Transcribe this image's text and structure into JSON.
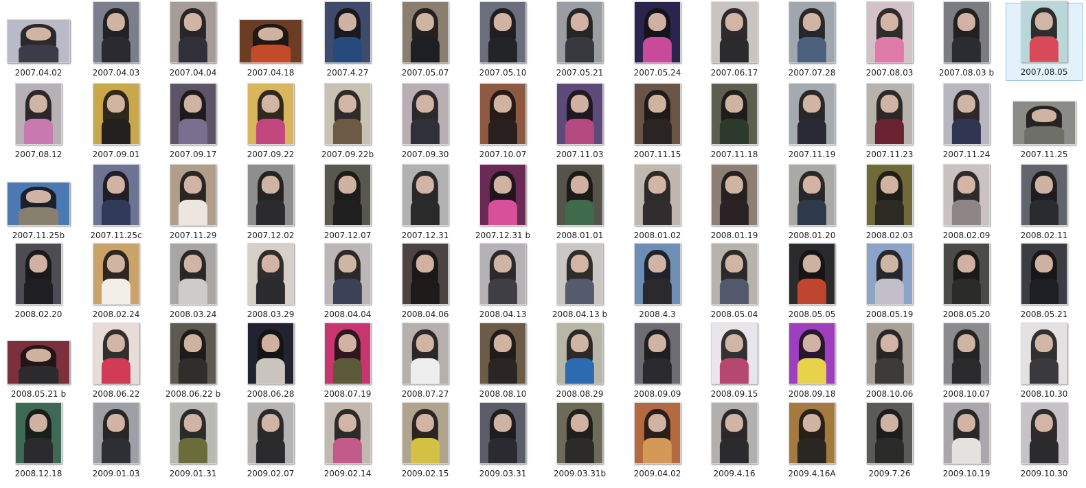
{
  "folder": {
    "rows": [
      [
        {
          "name": "2007.04.02",
          "shape": "landscape",
          "bg": "#b9b9c7",
          "body": "#3b3b4a"
        },
        {
          "name": "2007.04.03",
          "shape": "portrait",
          "bg": "#7b7f8c",
          "body": "#2b2a30"
        },
        {
          "name": "2007.04.04",
          "shape": "portrait",
          "bg": "#a59c97",
          "body": "#313039"
        },
        {
          "name": "2007.04.18",
          "shape": "landscape",
          "bg": "#6b3e24",
          "body": "#c24b2b"
        },
        {
          "name": "2007.4.27",
          "shape": "portrait",
          "bg": "#3e4b6c",
          "body": "#274a7d"
        },
        {
          "name": "2007.05.07",
          "shape": "portrait",
          "bg": "#8a7f6e",
          "body": "#1e1f24"
        },
        {
          "name": "2007.05.10",
          "shape": "portrait",
          "bg": "#6b6e7d",
          "body": "#232428"
        },
        {
          "name": "2007.05.21",
          "shape": "portrait",
          "bg": "#9a9da2",
          "body": "#37393f"
        },
        {
          "name": "2007.05.24",
          "shape": "portrait",
          "bg": "#2a244e",
          "body": "#c84b9b"
        },
        {
          "name": "2007.06.17",
          "shape": "portrait",
          "bg": "#c8c4c1",
          "body": "#2b2a2d"
        },
        {
          "name": "2007.07.28",
          "shape": "portrait",
          "bg": "#9fa6ad",
          "body": "#4c5f7d"
        },
        {
          "name": "2007.08.03",
          "shape": "portrait",
          "bg": "#d2c2c7",
          "body": "#e07aa8"
        },
        {
          "name": "2007.08.03 b",
          "shape": "portrait",
          "bg": "#7a7c82",
          "body": "#2b2c31"
        },
        {
          "name": "2007.08.05",
          "shape": "portrait",
          "bg": "#b9d6d8",
          "body": "#d84a5a",
          "selected": true
        }
      ],
      [
        {
          "name": "2007.08.12",
          "shape": "portrait",
          "bg": "#b7b1b6",
          "body": "#c97ab0"
        },
        {
          "name": "2007.09.01",
          "shape": "portrait",
          "bg": "#c8a84b",
          "body": "#22211f"
        },
        {
          "name": "2007.09.17",
          "shape": "portrait",
          "bg": "#5e5468",
          "body": "#7a6f8e"
        },
        {
          "name": "2007.09.22",
          "shape": "portrait",
          "bg": "#d9b65e",
          "body": "#c2467f"
        },
        {
          "name": "2007.09.22b",
          "shape": "portrait",
          "bg": "#c9c1b2",
          "body": "#6c5a44"
        },
        {
          "name": "2007.09.30",
          "shape": "portrait",
          "bg": "#b8aeb3",
          "body": "#30303a"
        },
        {
          "name": "2007.10.07",
          "shape": "portrait",
          "bg": "#8f5a42",
          "body": "#2a2020"
        },
        {
          "name": "2007.11.03",
          "shape": "portrait",
          "bg": "#5e4a7a",
          "body": "#b44a7f"
        },
        {
          "name": "2007.11.15",
          "shape": "portrait",
          "bg": "#6a5447",
          "body": "#2a2422"
        },
        {
          "name": "2007.11.18",
          "shape": "portrait",
          "bg": "#5c5e4f",
          "body": "#2d3a2b"
        },
        {
          "name": "2007.11.19",
          "shape": "portrait",
          "bg": "#a5a9b0",
          "body": "#2a2a36"
        },
        {
          "name": "2007.11.23",
          "shape": "portrait",
          "bg": "#b7b2ab",
          "body": "#6a2331"
        },
        {
          "name": "2007.11.24",
          "shape": "portrait",
          "bg": "#b8b6be",
          "body": "#303552"
        },
        {
          "name": "2007.11.25",
          "shape": "landscape",
          "bg": "#8b8b88",
          "body": "#6f6f6a"
        }
      ],
      [
        {
          "name": "2007.11.25b",
          "shape": "landscape",
          "bg": "#4c79b4",
          "body": "#88806e"
        },
        {
          "name": "2007.11.25c",
          "shape": "portrait",
          "bg": "#6c7393",
          "body": "#313a5b"
        },
        {
          "name": "2007.11.29",
          "shape": "portrait",
          "bg": "#b19e8a",
          "body": "#ece6df"
        },
        {
          "name": "2007.12.02",
          "shape": "portrait",
          "bg": "#8e8e8f",
          "body": "#2b2b2d"
        },
        {
          "name": "2007.12.07",
          "shape": "portrait",
          "bg": "#59584f",
          "body": "#1f1f20"
        },
        {
          "name": "2007.12.31",
          "shape": "portrait",
          "bg": "#b2b1b2",
          "body": "#2a2a2b"
        },
        {
          "name": "2007.12.31 b",
          "shape": "portrait",
          "bg": "#6a2a56",
          "body": "#d84f9a"
        },
        {
          "name": "2008.01.01",
          "shape": "portrait",
          "bg": "#56534a",
          "body": "#3f6b4c"
        },
        {
          "name": "2008.01.02",
          "shape": "portrait",
          "bg": "#c0b8ae",
          "body": "#322c2e"
        },
        {
          "name": "2008.01.19",
          "shape": "portrait",
          "bg": "#8e7f76",
          "body": "#2a2224"
        },
        {
          "name": "2008.01.20",
          "shape": "portrait",
          "bg": "#a9a9a6",
          "body": "#2e3a4a"
        },
        {
          "name": "2008.02.03",
          "shape": "portrait",
          "bg": "#6f6a37",
          "body": "#2b2a23"
        },
        {
          "name": "2008.02.09",
          "shape": "portrait",
          "bg": "#c9c2c1",
          "body": "#8e8586"
        },
        {
          "name": "2008.02.11",
          "shape": "portrait",
          "bg": "#61646c",
          "body": "#2a2b31"
        }
      ],
      [
        {
          "name": "2008.02.20",
          "shape": "portrait",
          "bg": "#4d4c52",
          "body": "#1f1e23"
        },
        {
          "name": "2008.02.24",
          "shape": "portrait",
          "bg": "#c9a36a",
          "body": "#f2efe8"
        },
        {
          "name": "2008.03.24",
          "shape": "portrait",
          "bg": "#a8a6a4",
          "body": "#cfcbc8"
        },
        {
          "name": "2008.03.29",
          "shape": "portrait",
          "bg": "#d6d0c8",
          "body": "#2b2a2c"
        },
        {
          "name": "2008.04.04",
          "shape": "portrait",
          "bg": "#bcb6b7",
          "body": "#3b4257"
        },
        {
          "name": "2008.04.06",
          "shape": "portrait",
          "bg": "#4b4443",
          "body": "#1f1b1b"
        },
        {
          "name": "2008.04.13",
          "shape": "portrait",
          "bg": "#b4b2b5",
          "body": "#3f3f45"
        },
        {
          "name": "2008.04.13 b",
          "shape": "portrait",
          "bg": "#c9c6c3",
          "body": "#565a6d"
        },
        {
          "name": "2008.4.3",
          "shape": "portrait",
          "bg": "#6d8fb5",
          "body": "#2a2a2e"
        },
        {
          "name": "2008.05.04",
          "shape": "portrait",
          "bg": "#b6b3ad",
          "body": "#53596d"
        },
        {
          "name": "2008.05.05",
          "shape": "portrait",
          "bg": "#2b2a2c",
          "body": "#c0452f"
        },
        {
          "name": "2008.05.19",
          "shape": "portrait",
          "bg": "#8da3c7",
          "body": "#c2bfc8"
        },
        {
          "name": "2008.05.20",
          "shape": "portrait",
          "bg": "#4b4c48",
          "body": "#2b2c2a"
        },
        {
          "name": "2008.05.21",
          "shape": "portrait",
          "bg": "#3c3d43",
          "body": "#1e1f24"
        }
      ],
      [
        {
          "name": "2008.05.21 b",
          "shape": "landscape",
          "bg": "#7c2f3c",
          "body": "#2b2a2d"
        },
        {
          "name": "2008.06.22",
          "shape": "portrait",
          "bg": "#e6dcd8",
          "body": "#d03c55"
        },
        {
          "name": "2008.06.22 b",
          "shape": "portrait",
          "bg": "#5c5a51",
          "body": "#2f2e2b"
        },
        {
          "name": "2008.06.28",
          "shape": "portrait",
          "bg": "#222230",
          "body": "#c9c4be"
        },
        {
          "name": "2008.07.19",
          "shape": "portrait",
          "bg": "#c9356e",
          "body": "#5d5a3a"
        },
        {
          "name": "2008.07.27",
          "shape": "portrait",
          "bg": "#b6b0ad",
          "body": "#eeeeee"
        },
        {
          "name": "2008.08.10",
          "shape": "portrait",
          "bg": "#6b5b47",
          "body": "#2b2523"
        },
        {
          "name": "2008.08.29",
          "shape": "portrait",
          "bg": "#b8b6a6",
          "body": "#2c6bb1"
        },
        {
          "name": "2008.09.09",
          "shape": "portrait",
          "bg": "#6e6d73",
          "body": "#2b2a2f"
        },
        {
          "name": "2008.09.15",
          "shape": "portrait",
          "bg": "#e8e6ea",
          "body": "#b6476e"
        },
        {
          "name": "2008.09.18",
          "shape": "portrait",
          "bg": "#9e3fc0",
          "body": "#e8d24b"
        },
        {
          "name": "2008.10.06",
          "shape": "portrait",
          "bg": "#a8a098",
          "body": "#3e3a37"
        },
        {
          "name": "2008.10.07",
          "shape": "portrait",
          "bg": "#8b8a8c",
          "body": "#2b2b2d"
        },
        {
          "name": "2008.10.30",
          "shape": "portrait",
          "bg": "#e4e1e3",
          "body": "#3a3a3e"
        }
      ],
      [
        {
          "name": "2008.12.18",
          "shape": "portrait",
          "bg": "#3e6a55",
          "body": "#2b2a2c"
        },
        {
          "name": "2009.01.03",
          "shape": "portrait",
          "bg": "#9fa0a5",
          "body": "#2e2e35"
        },
        {
          "name": "2009.01.31",
          "shape": "portrait",
          "bg": "#b7b9b2",
          "body": "#6a6d39"
        },
        {
          "name": "2009.02.07",
          "shape": "portrait",
          "bg": "#b6b4b3",
          "body": "#2b2a2c"
        },
        {
          "name": "2009.02.14",
          "shape": "portrait",
          "bg": "#c3b8b0",
          "body": "#c25a8a"
        },
        {
          "name": "2009.02.15",
          "shape": "portrait",
          "bg": "#b0a48f",
          "body": "#d4c042"
        },
        {
          "name": "2009.03.31",
          "shape": "portrait",
          "bg": "#5b5d68",
          "body": "#2a2a30"
        },
        {
          "name": "2009.03.31b",
          "shape": "portrait",
          "bg": "#6d6a58",
          "body": "#2c2b28"
        },
        {
          "name": "2009.04.02",
          "shape": "portrait",
          "bg": "#b46a3e",
          "body": "#d29a56"
        },
        {
          "name": "2009.4.16",
          "shape": "portrait",
          "bg": "#b2b0ae",
          "body": "#2b2a2d"
        },
        {
          "name": "2009.4.16A",
          "shape": "portrait",
          "bg": "#a47a3e",
          "body": "#2a2622"
        },
        {
          "name": "2009.7.26",
          "shape": "portrait",
          "bg": "#5a5a58",
          "body": "#2b2b2a"
        },
        {
          "name": "2009.10.19",
          "shape": "portrait",
          "bg": "#a9a7ab",
          "body": "#e4e2de"
        },
        {
          "name": "2009.10.30",
          "shape": "portrait",
          "bg": "#c6c3c6",
          "body": "#2b2a2d"
        }
      ]
    ]
  }
}
